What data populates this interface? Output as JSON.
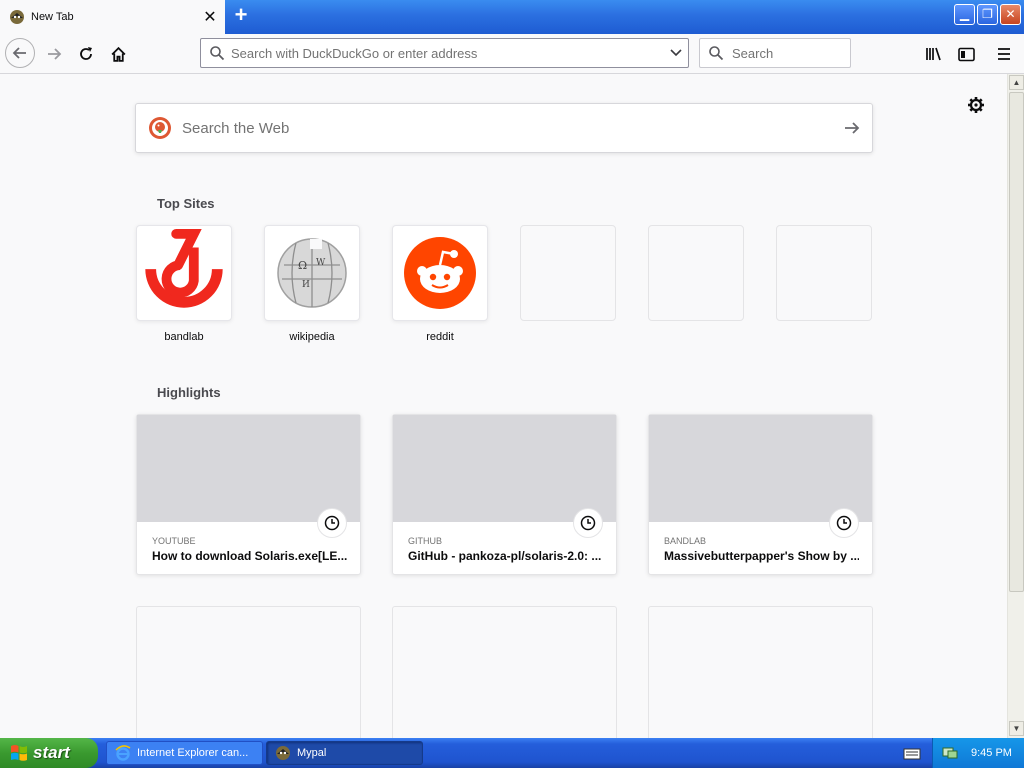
{
  "browser": {
    "tab": {
      "title": "New Tab",
      "close_glyph": "✕"
    },
    "new_tab_glyph": "+",
    "window_controls": {
      "minimize": "▁",
      "maximize": "❐",
      "close": "✕"
    },
    "urlbar": {
      "placeholder": "Search with DuckDuckGo or enter address"
    },
    "searchbar": {
      "placeholder": "Search"
    }
  },
  "newtab": {
    "web_search": {
      "placeholder": "Search the Web"
    },
    "top_sites_title": "Top Sites",
    "top_sites": [
      {
        "label": "bandlab",
        "icon": "bandlab-logo",
        "color": "#f0281e"
      },
      {
        "label": "wikipedia",
        "icon": "wikipedia-globe",
        "color": "#cfcfcf"
      },
      {
        "label": "reddit",
        "icon": "reddit-alien",
        "color": "#ff4500"
      },
      {
        "label": "",
        "icon": ""
      },
      {
        "label": "",
        "icon": ""
      },
      {
        "label": "",
        "icon": ""
      }
    ],
    "highlights_title": "Highlights",
    "highlights": [
      {
        "source": "YOUTUBE",
        "title": "How to download Solaris.exe[LE..."
      },
      {
        "source": "GITHUB",
        "title": "GitHub - pankoza-pl/solaris-2.0: ..."
      },
      {
        "source": "BANDLAB",
        "title": "Massivebutterpapper's Show by ..."
      }
    ]
  },
  "taskbar": {
    "start_label": "start",
    "tasks": [
      {
        "label": "Internet Explorer can...",
        "icon": "ie-icon"
      },
      {
        "label": "Mypal",
        "icon": "mypal-icon"
      }
    ],
    "clock": "9:45 PM"
  },
  "colors": {
    "titlebar_blue": "#2b6fe0",
    "start_green": "#3a9a2f",
    "reddit": "#ff4500",
    "bandlab": "#f0281e"
  }
}
